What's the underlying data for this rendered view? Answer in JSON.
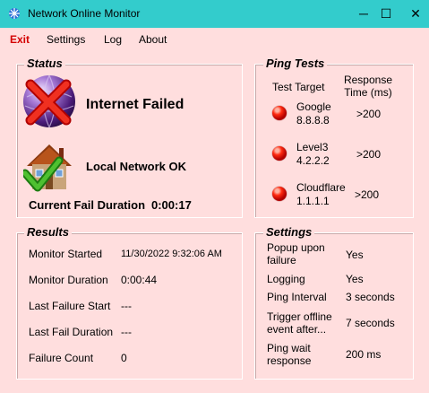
{
  "window": {
    "title": "Network Online Monitor"
  },
  "menu": {
    "exit": "Exit",
    "settings": "Settings",
    "log": "Log",
    "about": "About"
  },
  "status": {
    "title": "Status",
    "internet": "Internet Failed",
    "local": "Local Network OK",
    "fail_duration_label": "Current Fail Duration",
    "fail_duration_value": "0:00:17"
  },
  "ping": {
    "title": "Ping Tests",
    "col_target": "Test Target",
    "col_response_1": "Response",
    "col_response_2": "Time (ms)",
    "rows": [
      {
        "name": "Google",
        "ip": "8.8.8.8",
        "time": ">200"
      },
      {
        "name": "Level3",
        "ip": "4.2.2.2",
        "time": ">200"
      },
      {
        "name": "Cloudflare",
        "ip": "1.1.1.1",
        "time": ">200"
      }
    ]
  },
  "results": {
    "title": "Results",
    "monitor_started_label": "Monitor Started",
    "monitor_started_value": "11/30/2022 9:32:06 AM",
    "monitor_duration_label": "Monitor Duration",
    "monitor_duration_value": "0:00:44",
    "last_failure_start_label": "Last Failure Start",
    "last_failure_start_value": "---",
    "last_fail_duration_label": "Last Fail Duration",
    "last_fail_duration_value": "---",
    "failure_count_label": "Failure Count",
    "failure_count_value": "0"
  },
  "settings": {
    "title": "Settings",
    "popup_label_1": "Popup upon",
    "popup_label_2": "failure",
    "popup_value": "Yes",
    "logging_label": "Logging",
    "logging_value": "Yes",
    "ping_interval_label": "Ping Interval",
    "ping_interval_value": "3 seconds",
    "trigger_label_1": "Trigger offline",
    "trigger_label_2": "event after...",
    "trigger_value": "7 seconds",
    "ping_wait_label_1": "Ping wait",
    "ping_wait_label_2": "response",
    "ping_wait_value": "200 ms"
  },
  "colors": {
    "titlebar": "#33cccc",
    "background": "#ffdede",
    "exit": "#d40000",
    "status_red": "#ff2a10"
  },
  "icons": [
    "app-network-icon",
    "minimize-icon",
    "maximize-icon",
    "close-icon",
    "internet-failed-globe-icon",
    "local-network-ok-house-icon",
    "red-status-dot-icon"
  ]
}
